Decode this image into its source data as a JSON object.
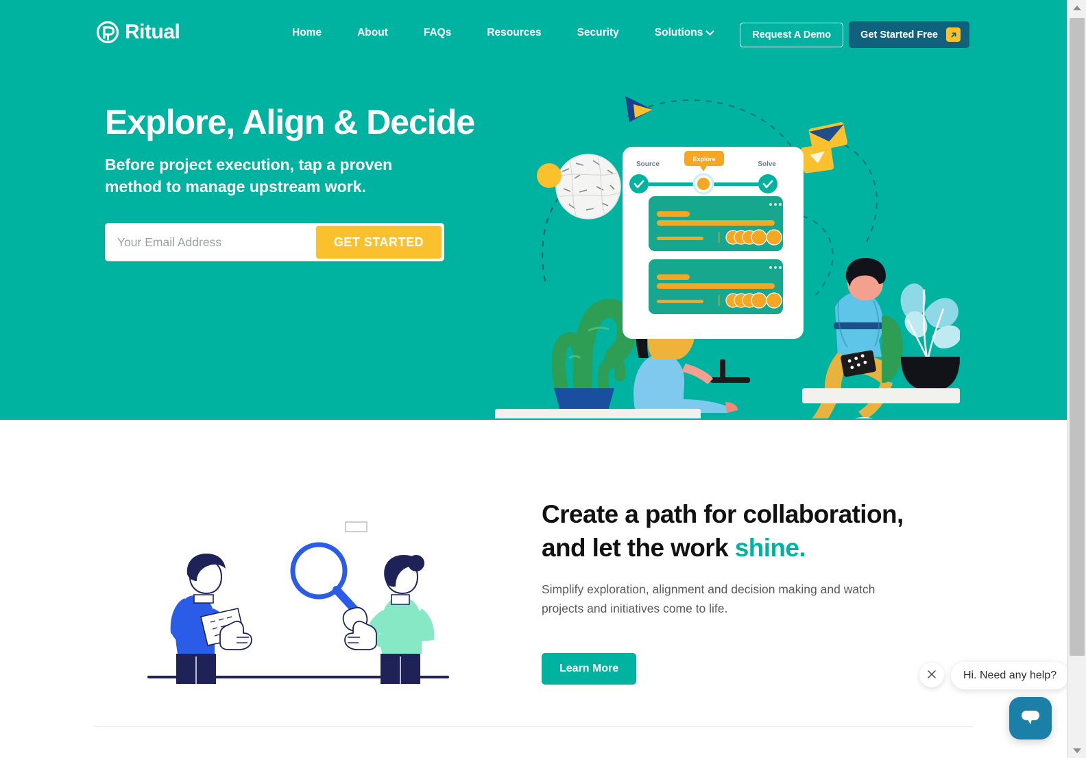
{
  "brand": {
    "name": "Ritual",
    "logo_icon": "ritual-circle-pin-logo",
    "color": "#00b3a0"
  },
  "nav": {
    "links": [
      {
        "label": "Home",
        "has_dropdown": false
      },
      {
        "label": "About",
        "has_dropdown": false
      },
      {
        "label": "FAQs",
        "has_dropdown": false
      },
      {
        "label": "Resources",
        "has_dropdown": false
      },
      {
        "label": "Security",
        "has_dropdown": false
      },
      {
        "label": "Solutions",
        "has_dropdown": true
      }
    ],
    "demo_button": "Request A Demo",
    "start_button": "Get Started Free",
    "start_button_icon": "external-link-arrow-icon",
    "start_button_color": "#10617c",
    "start_button_icon_color": "#fbc02d"
  },
  "hero": {
    "title": "Explore, Align & Decide",
    "subtitle": "Before project execution, tap a proven method to manage upstream work.",
    "email_placeholder": "Your Email Address",
    "email_value": "",
    "cta_label": "GET STARTED",
    "cta_color": "#fbc02d",
    "background_color": "#00b3a0",
    "illustration": {
      "name": "team-collaboration-dashboard-illustration",
      "card_steps": [
        {
          "label": "Source",
          "state": "complete"
        },
        {
          "label": "Explore",
          "state": "current"
        },
        {
          "label": "Solve",
          "state": "complete"
        }
      ]
    }
  },
  "section2": {
    "title_part1": "Create a path for collaboration, and let the work ",
    "title_highlight": "shine.",
    "highlight_color": "#00b3a0",
    "body": "Simplify exploration, alignment and decision making and watch projects and initiatives come to life.",
    "cta_label": "Learn More",
    "illustration": {
      "name": "two-people-magnifying-glass-illustration"
    }
  },
  "chat": {
    "message": "Hi. Need any help?",
    "close_icon": "close-x-icon",
    "launcher_icon": "chat-message-icon",
    "launcher_color": "#1c7fa8"
  }
}
